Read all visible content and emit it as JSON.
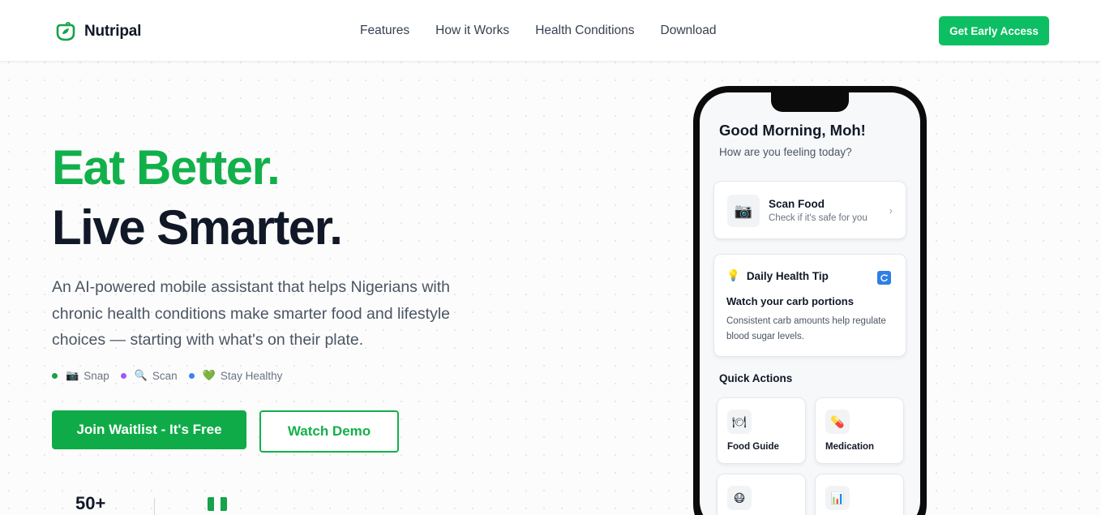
{
  "header": {
    "brand": "Nutripal",
    "nav": [
      "Features",
      "How it Works",
      "Health Conditions",
      "Download"
    ],
    "cta": "Get Early Access"
  },
  "hero": {
    "headline_green": "Eat Better.",
    "headline_dark": "Live Smarter.",
    "subtitle": "An AI-powered mobile assistant that helps Nigerians with chronic health conditions make smarter food and lifestyle choices — starting with what's on their plate.",
    "tags": [
      {
        "label": "Snap",
        "dot_color": "#16a34a",
        "icon": "camera-icon",
        "glyph": "📷"
      },
      {
        "label": "Scan",
        "dot_color": "#a855f7",
        "icon": "magnifier-icon",
        "glyph": "🔍"
      },
      {
        "label": "Stay Healthy",
        "dot_color": "#3b82f6",
        "icon": "heart-icon",
        "glyph": "💚"
      }
    ],
    "primary_button": "Join Waitlist - It's Free",
    "secondary_button": "Watch Demo",
    "stat_value": "50+"
  },
  "phone": {
    "greeting": "Good Morning, Moh!",
    "greeting_sub": "How are you feeling today?",
    "scan_card": {
      "title": "Scan Food",
      "subtitle": "Check if it's safe for you",
      "icon": "camera-icon",
      "glyph": "📷",
      "chevron": "›"
    },
    "tip_card": {
      "heading": "Daily Health Tip",
      "icon": "lightbulb-icon",
      "glyph": "💡",
      "refresh_glyph": "🔄",
      "title": "Watch your carb portions",
      "body": "Consistent carb amounts help regulate blood sugar levels."
    },
    "quick_actions_title": "Quick Actions",
    "quick_actions": [
      {
        "label": "Food Guide",
        "icon": "food-guide-icon",
        "glyph": "🍽"
      },
      {
        "label": "Medication",
        "icon": "pill-icon",
        "glyph": "💊"
      },
      {
        "label": "",
        "icon": "face-icon",
        "glyph": "😷"
      },
      {
        "label": "",
        "icon": "chart-icon",
        "glyph": "📊"
      }
    ]
  },
  "colors": {
    "brand_green": "#12b04b",
    "cta_green": "#0dbf63",
    "flag_green": "#16a34a"
  }
}
